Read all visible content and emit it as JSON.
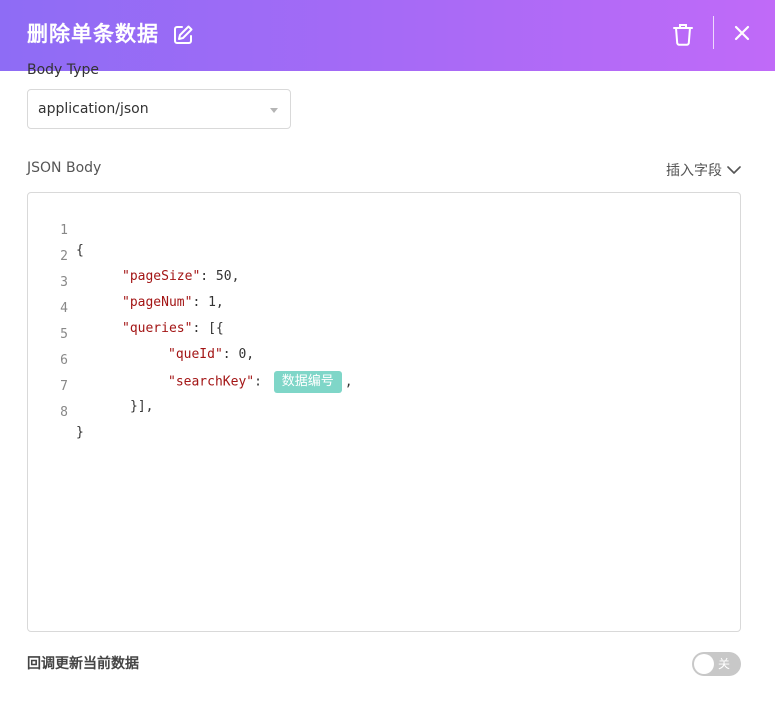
{
  "header": {
    "title": "删除单条数据",
    "gradient_start": "#8e6cf5",
    "gradient_end": "#c06af8"
  },
  "body_type": {
    "label": "Body Type",
    "selected": "application/json"
  },
  "json_body": {
    "label": "JSON Body",
    "insert_field_label": "插入字段",
    "lines": [
      {
        "num": "1"
      },
      {
        "num": "2",
        "key": "\"pageSize\"",
        "rest": ": 50,"
      },
      {
        "num": "3",
        "key": "\"pageNum\"",
        "rest": ": 1,"
      },
      {
        "num": "4",
        "key": "\"queries\"",
        "rest": ": [{"
      },
      {
        "num": "5",
        "key": "\"queId\"",
        "rest": ": 0,"
      },
      {
        "num": "6",
        "key": "\"searchKey\"",
        "rest": ": ",
        "chip": "数据编号",
        "after": ","
      },
      {
        "num": "7",
        "text": "}],"
      },
      {
        "num": "8",
        "text": "}"
      }
    ],
    "first_line_text": "{",
    "chip_color": "#7fd6c8"
  },
  "callback": {
    "label": "回调更新当前数据",
    "toggle_text": "关",
    "toggle_on": false
  },
  "icons": {
    "edit": "edit-icon",
    "trash": "trash-icon",
    "close": "close-icon",
    "chevron": "chevron-down-icon"
  }
}
